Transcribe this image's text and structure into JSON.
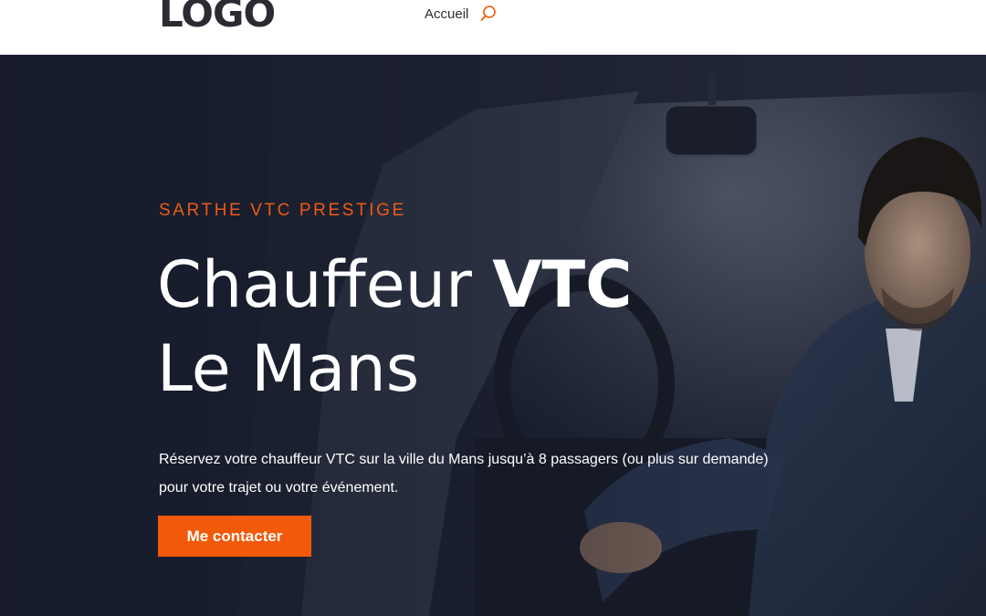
{
  "header": {
    "logo_text": "LOGO",
    "nav": [
      {
        "label": "Accueil"
      }
    ],
    "search_icon": "search-icon"
  },
  "hero": {
    "eyebrow": "SARTHE VTC PRESTIGE",
    "title_light": "Chauffeur ",
    "title_bold": "VTC",
    "title_line2": "Le Mans",
    "description": "Réservez votre chauffeur VTC sur la ville du Mans jusqu’à 8 passagers (ou plus sur demande) pour votre trajet ou votre événement.",
    "cta_label": "Me contacter"
  },
  "colors": {
    "accent": "#f25a0a",
    "eyebrow": "#ec5a13",
    "header_bg": "#ffffff",
    "hero_bg": "#1d2233",
    "text_dark": "#2b2b33"
  }
}
